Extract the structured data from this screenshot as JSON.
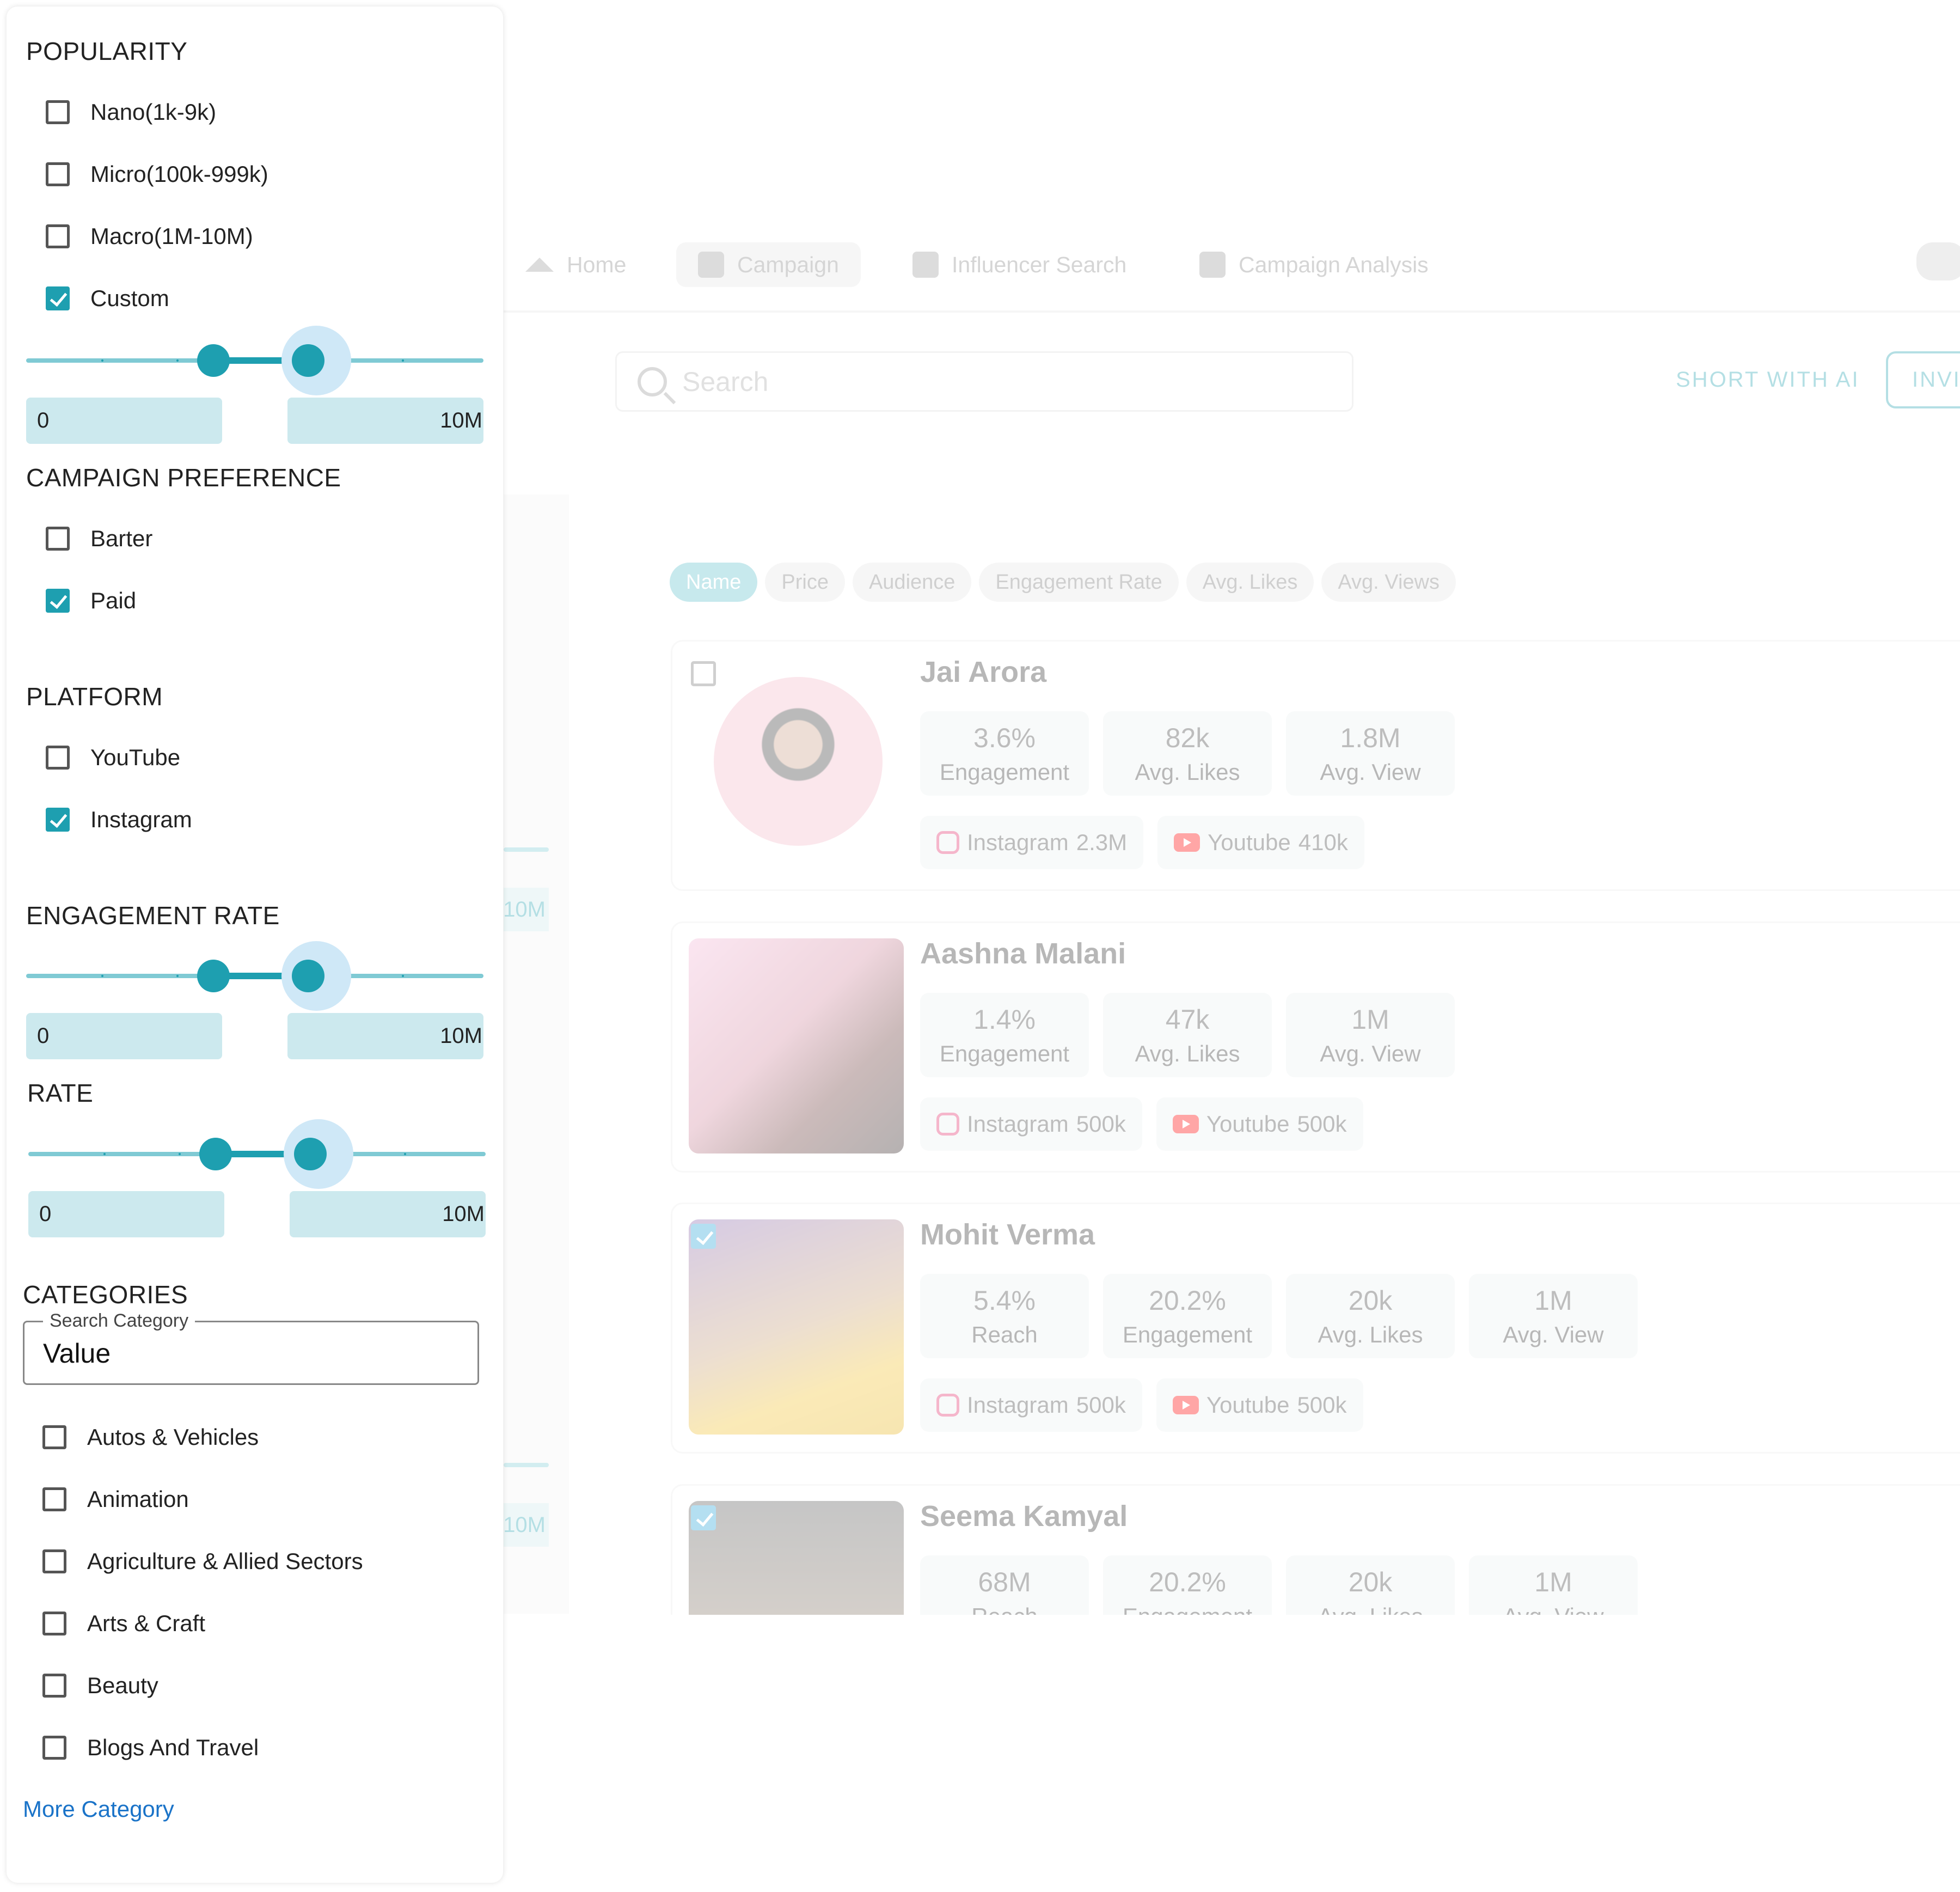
{
  "nav": {
    "items": [
      {
        "label": "Home",
        "icon": "home-icon"
      },
      {
        "label": "Campaign",
        "icon": "checklist-icon",
        "active": true
      },
      {
        "label": "Influencer Search",
        "icon": "checklist-icon"
      },
      {
        "label": "Campaign Analysis",
        "icon": "checklist-icon"
      }
    ],
    "chat_icon": "chat-icon"
  },
  "search": {
    "placeholder": "Search"
  },
  "toolbar": {
    "short_ai": "SHORT  WITH AI",
    "invite": "INVI"
  },
  "ghost_values": {
    "max1": "10M",
    "max2": "10M"
  },
  "sort_chips": [
    "Name",
    "Price",
    "Audience",
    "Engagement Rate",
    "Avg. Likes",
    "Avg. Views"
  ],
  "influencers": [
    {
      "name": "Jai Arora",
      "checked": false,
      "stats": [
        {
          "v": "3.6%",
          "l": "Engagement"
        },
        {
          "v": "82k",
          "l": "Avg. Likes"
        },
        {
          "v": "1.8M",
          "l": "Avg. View"
        }
      ],
      "instagram": {
        "label": "Instagram",
        "count": "2.3M"
      },
      "youtube": {
        "label": "Youtube",
        "count": "410k"
      }
    },
    {
      "name": "Aashna Malani",
      "checked": false,
      "stats": [
        {
          "v": "1.4%",
          "l": "Engagement"
        },
        {
          "v": "47k",
          "l": "Avg. Likes"
        },
        {
          "v": "1M",
          "l": "Avg. View"
        }
      ],
      "instagram": {
        "label": "Instagram",
        "count": "500k"
      },
      "youtube": {
        "label": "Youtube",
        "count": "500k"
      }
    },
    {
      "name": "Mohit Verma",
      "checked": true,
      "stats": [
        {
          "v": "5.4%",
          "l": "Reach"
        },
        {
          "v": "20.2%",
          "l": "Engagement"
        },
        {
          "v": "20k",
          "l": "Avg. Likes"
        },
        {
          "v": "1M",
          "l": "Avg. View"
        }
      ],
      "instagram": {
        "label": "Instagram",
        "count": "500k"
      },
      "youtube": {
        "label": "Youtube",
        "count": "500k"
      }
    },
    {
      "name": "Seema Kamyal",
      "checked": true,
      "stats": [
        {
          "v": "68M",
          "l": "Reach"
        },
        {
          "v": "20.2%",
          "l": "Engagement"
        },
        {
          "v": "20k",
          "l": "Avg. Likes"
        },
        {
          "v": "1M",
          "l": "Avg. View"
        }
      ]
    }
  ],
  "filters": {
    "popularity": {
      "title": "POPULARITY",
      "options": [
        {
          "label": "Nano(1k-9k)",
          "checked": false
        },
        {
          "label": "Micro(100k-999k)",
          "checked": false
        },
        {
          "label": "Macro(1M-10M)",
          "checked": false
        },
        {
          "label": "Custom",
          "checked": true
        }
      ],
      "range": {
        "min": "0",
        "max": "10M"
      }
    },
    "campaign_preference": {
      "title": "CAMPAIGN PREFERENCE",
      "options": [
        {
          "label": "Barter",
          "checked": false
        },
        {
          "label": "Paid",
          "checked": true
        }
      ]
    },
    "platform": {
      "title": "PLATFORM",
      "options": [
        {
          "label": "YouTube",
          "checked": false
        },
        {
          "label": "Instagram",
          "checked": true
        }
      ]
    },
    "engagement_rate": {
      "title": "ENGAGEMENT RATE",
      "range": {
        "min": "0",
        "max": "10M"
      }
    },
    "rate": {
      "title": "RATE",
      "range": {
        "min": "0",
        "max": "10M"
      }
    },
    "categories": {
      "title": "CATEGORIES",
      "search_label": "Search Category",
      "search_value": "Value",
      "options": [
        {
          "label": "Autos & Vehicles",
          "checked": false
        },
        {
          "label": "Animation",
          "checked": false
        },
        {
          "label": "Agriculture & Allied Sectors",
          "checked": false
        },
        {
          "label": "Arts & Craft",
          "checked": false
        },
        {
          "label": "Beauty",
          "checked": false
        },
        {
          "label": "Blogs And Travel",
          "checked": false
        }
      ],
      "more_link": "More Category"
    }
  },
  "colors": {
    "accent": "#1e9fb0",
    "link": "#1a73c8",
    "instagram": "#e1306c",
    "youtube": "#ff0000"
  }
}
